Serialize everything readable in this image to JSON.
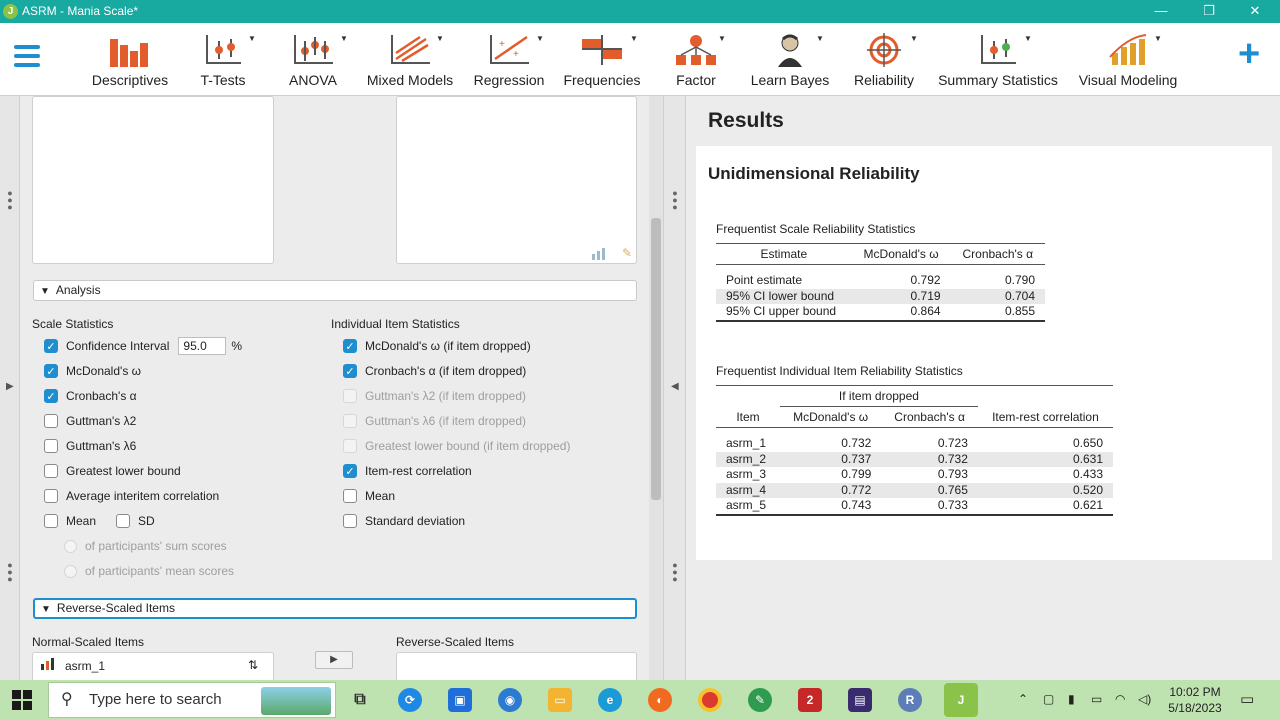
{
  "window": {
    "title": "ASRM - Mania Scale*",
    "minimize": "—",
    "restore": "❐",
    "close": "✕"
  },
  "ribbon": {
    "items": [
      {
        "label": "Descriptives",
        "icon": "descriptives-icon"
      },
      {
        "label": "T-Tests",
        "icon": "t-tests-icon"
      },
      {
        "label": "ANOVA",
        "icon": "anova-icon"
      },
      {
        "label": "Mixed Models",
        "icon": "mixed-models-icon"
      },
      {
        "label": "Regression",
        "icon": "regression-icon"
      },
      {
        "label": "Frequencies",
        "icon": "frequencies-icon"
      },
      {
        "label": "Factor",
        "icon": "factor-icon"
      },
      {
        "label": "Learn Bayes",
        "icon": "learn-bayes-icon"
      },
      {
        "label": "Reliability",
        "icon": "reliability-icon"
      },
      {
        "label": "Summary Statistics",
        "icon": "summary-statistics-icon"
      },
      {
        "label": "Visual Modeling",
        "icon": "visual-modeling-icon"
      }
    ],
    "plus": "+"
  },
  "analysis": {
    "section_label": "Analysis",
    "scale_title": "Scale Statistics",
    "item_title": "Individual Item Statistics",
    "ci_label": "Confidence Interval",
    "ci_value": "95.0",
    "ci_unit": "%",
    "scale_options": {
      "mcdonald": "McDonald's ω",
      "cronbach": "Cronbach's α",
      "guttman2": "Guttman's λ2",
      "guttman6": "Guttman's λ6",
      "glb": "Greatest lower bound",
      "avg_inter": "Average interitem correlation",
      "mean": "Mean",
      "sd": "SD",
      "sum_scores": "of participants' sum scores",
      "mean_scores": "of participants' mean scores"
    },
    "item_options": {
      "mcdonald_drop": "McDonald's ω  (if item dropped)",
      "cronbach_drop": "Cronbach's α (if item dropped)",
      "guttman2_drop": "Guttman's λ2 (if item dropped)",
      "guttman6_drop": "Guttman's λ6 (if item dropped)",
      "glb_drop": "Greatest lower bound (if item dropped)",
      "item_rest": "Item-rest correlation",
      "mean": "Mean",
      "sd": "Standard deviation"
    }
  },
  "reverse": {
    "section_label": "Reverse-Scaled Items",
    "normal_title": "Normal-Scaled Items",
    "reverse_title": "Reverse-Scaled Items",
    "normal_items": [
      "asrm_1"
    ],
    "move_arrow": "▶",
    "sort_icon": "⇅"
  },
  "results": {
    "heading": "Results",
    "card_title": "Unidimensional Reliability",
    "scale_table": {
      "title": "Frequentist Scale Reliability Statistics",
      "headers": [
        "Estimate",
        "McDonald's ω",
        "Cronbach's α"
      ],
      "rows": [
        [
          "Point estimate",
          "0.792",
          "0.790"
        ],
        [
          "95% CI lower bound",
          "0.719",
          "0.704"
        ],
        [
          "95% CI upper bound",
          "0.864",
          "0.855"
        ]
      ]
    },
    "item_table": {
      "title": "Frequentist Individual Item Reliability Statistics",
      "group_header": "If item dropped",
      "headers": [
        "Item",
        "McDonald's ω",
        "Cronbach's α",
        "Item-rest correlation"
      ],
      "rows": [
        [
          "asrm_1",
          "0.732",
          "0.723",
          "0.650"
        ],
        [
          "asrm_2",
          "0.737",
          "0.732",
          "0.631"
        ],
        [
          "asrm_3",
          "0.799",
          "0.793",
          "0.433"
        ],
        [
          "asrm_4",
          "0.772",
          "0.765",
          "0.520"
        ],
        [
          "asrm_5",
          "0.743",
          "0.733",
          "0.621"
        ]
      ]
    }
  },
  "taskbar": {
    "search_placeholder": "Type here to search",
    "time": "10:02 PM",
    "date": "5/18/2023",
    "colors": {
      "accent": "#1f8ecf",
      "titlebar": "#18a9a0",
      "taskbar": "#bfe3b0"
    }
  }
}
